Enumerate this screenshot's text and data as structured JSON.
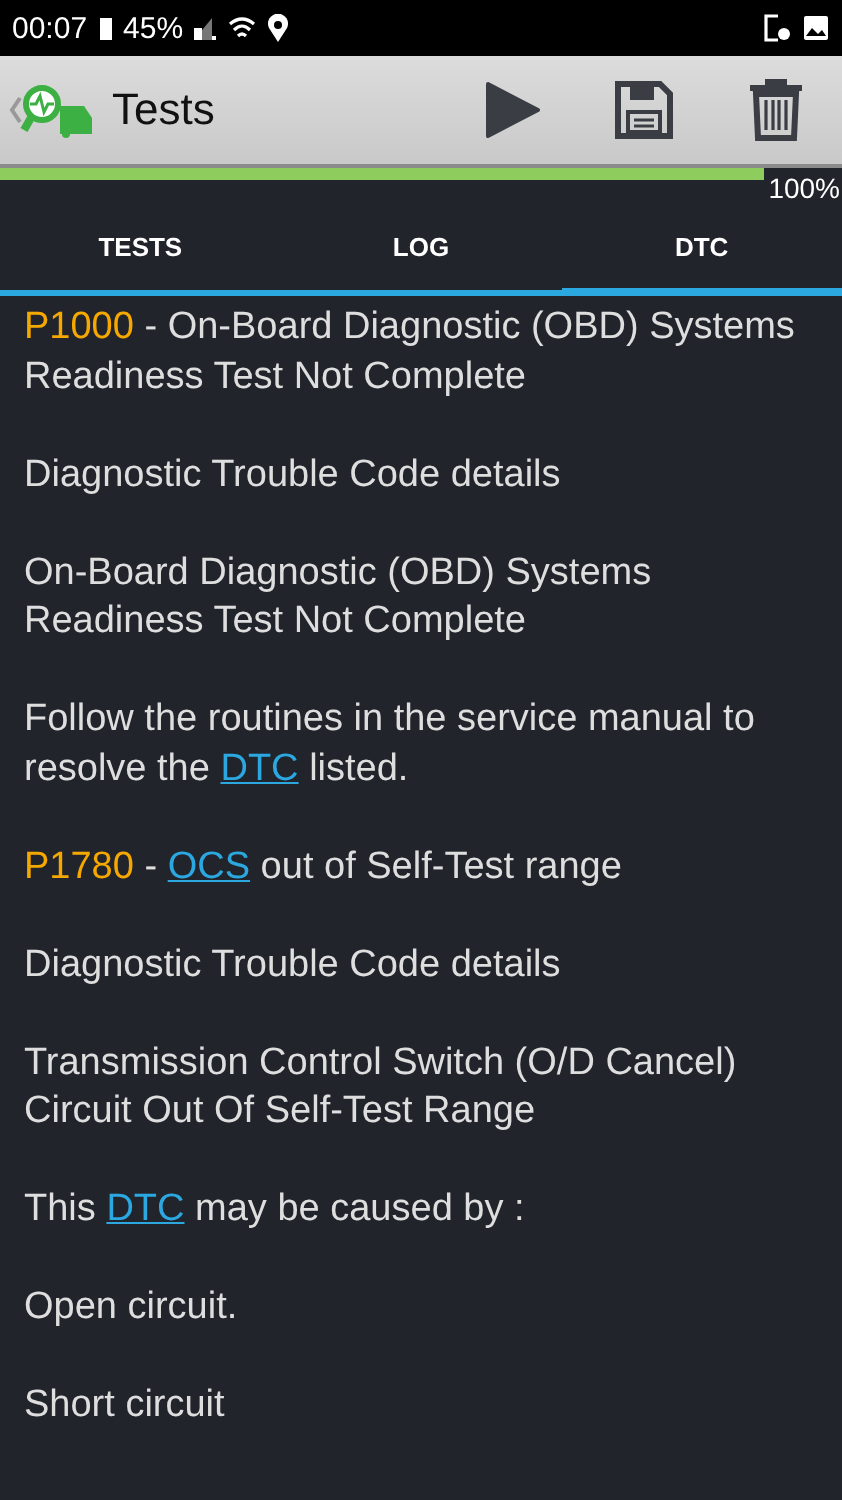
{
  "status_bar": {
    "time": "00:07",
    "battery": "45%"
  },
  "toolbar": {
    "title": "Tests"
  },
  "progress": {
    "level": 1,
    "reading": "100%"
  },
  "tabs": [
    {
      "label": "TESTS",
      "selected": false
    },
    {
      "label": "LOG",
      "selected": false
    },
    {
      "label": "DTC",
      "selected": true
    }
  ],
  "paragraphs": [
    [
      {
        "kind": "code",
        "text": "P1000"
      },
      {
        "kind": "text",
        "text": " - On-Board Diagnostic (OBD) Systems Readiness Test Not Complete"
      }
    ],
    [
      {
        "kind": "text",
        "text": "Diagnostic Trouble Code details"
      }
    ],
    [
      {
        "kind": "text",
        "text": "On-Board Diagnostic (OBD) Systems Readiness Test Not Complete"
      }
    ],
    [
      {
        "kind": "text",
        "text": "Follow the routines in the service manual to resolve the "
      },
      {
        "kind": "link",
        "text": "DTC"
      },
      {
        "kind": "text",
        "text": " listed."
      }
    ],
    [
      {
        "kind": "code",
        "text": "P1780"
      },
      {
        "kind": "text",
        "text": " - "
      },
      {
        "kind": "link",
        "text": "OCS"
      },
      {
        "kind": "text",
        "text": " out of Self-Test range"
      }
    ],
    [
      {
        "kind": "text",
        "text": "Diagnostic Trouble Code details"
      }
    ],
    [
      {
        "kind": "text",
        "text": "Transmission Control Switch (O/D Cancel) Circuit Out Of Self-Test Range"
      }
    ],
    [
      {
        "kind": "text",
        "text": "This "
      },
      {
        "kind": "link",
        "text": "DTC"
      },
      {
        "kind": "text",
        "text": " may be caused by :"
      }
    ],
    [
      {
        "kind": "text",
        "text": "Open circuit."
      }
    ],
    [
      {
        "kind": "text",
        "text": "Short circuit"
      }
    ]
  ]
}
